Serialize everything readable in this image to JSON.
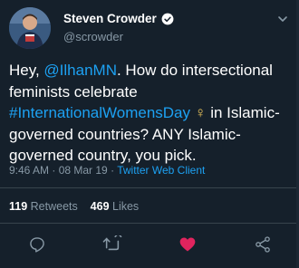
{
  "author": {
    "display_name": "Steven Crowder",
    "handle": "@scrowder",
    "verified": true
  },
  "tweet": {
    "text_intro": "Hey, ",
    "mention": "@IlhanMN",
    "text_mid": ". How do intersectional feminists celebrate ",
    "hashtag": "#InternationalWomensDay",
    "emoji": "♀",
    "text_end": " in Islamic-governed countries? ANY Islamic-governed country, you pick."
  },
  "meta": {
    "time": "9:46 AM",
    "separator1": " · ",
    "date": "08 Mar 19",
    "separator2": " · ",
    "client": "Twitter Web Client"
  },
  "stats": {
    "retweets_count": "119",
    "retweets_label": " Retweets",
    "likes_count": "469",
    "likes_label": " Likes"
  },
  "actions": {
    "reply": "reply-icon",
    "retweet": "retweet-icon",
    "like": "heart-icon",
    "share": "share-icon"
  },
  "colors": {
    "background": "#15202b",
    "link": "#1da1f2",
    "secondary_text": "#8899a6",
    "like_active": "#e0245e",
    "divider": "#38444d"
  }
}
